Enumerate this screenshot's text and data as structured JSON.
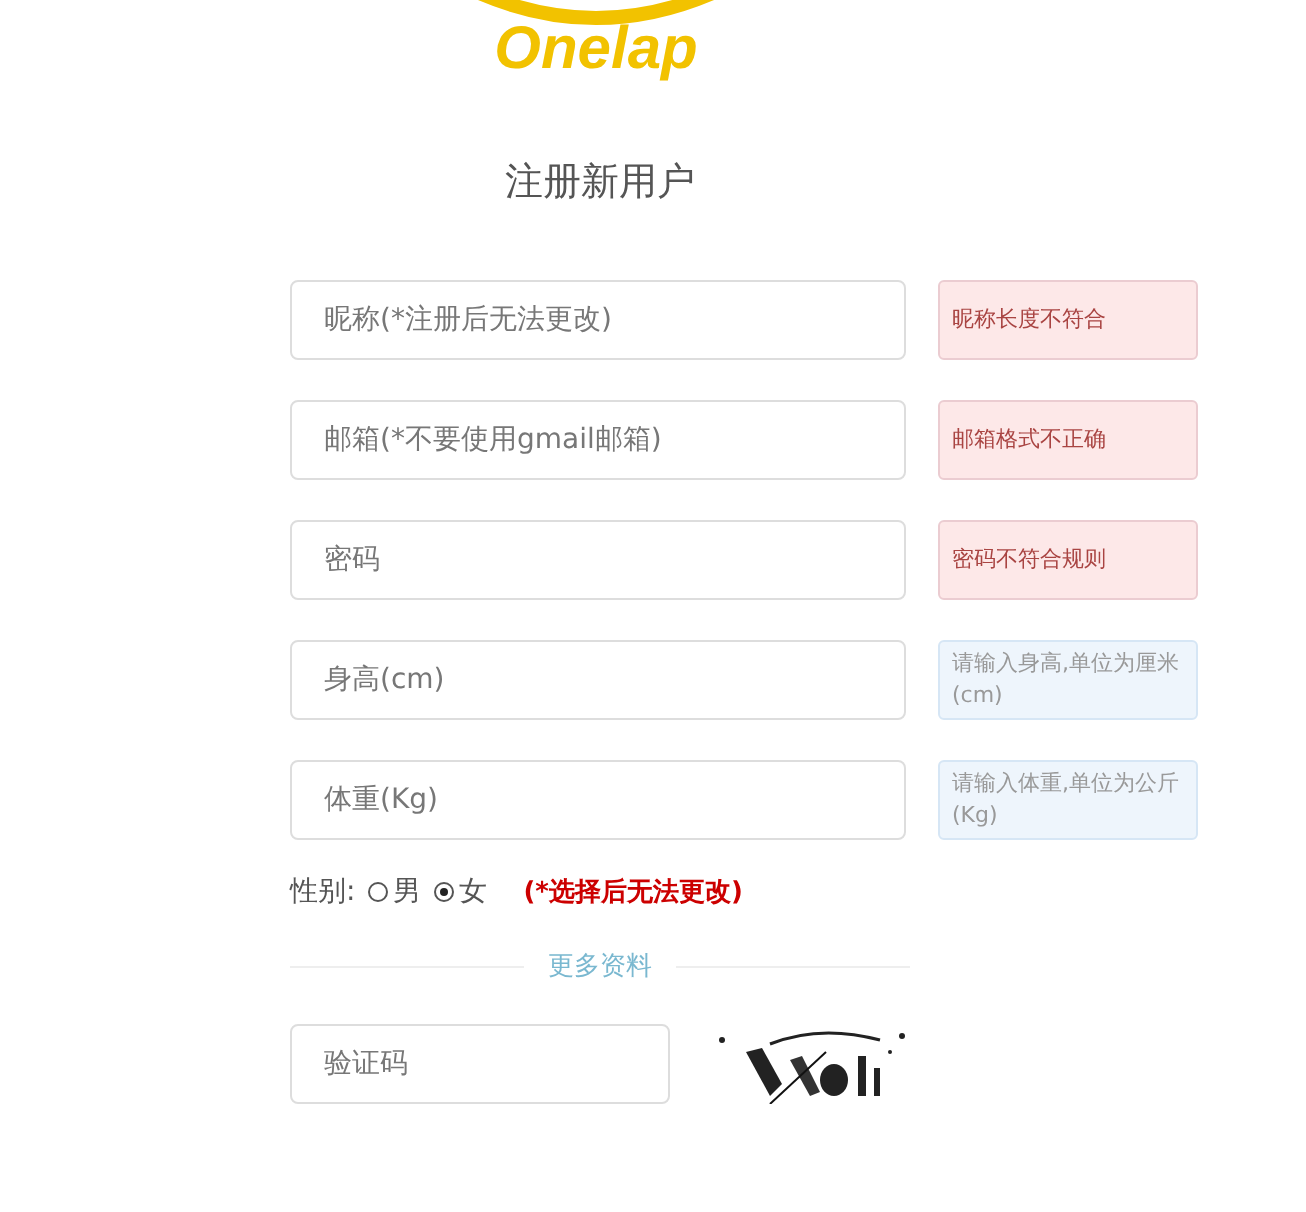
{
  "logo": {
    "text": "Onelap"
  },
  "title": "注册新用户",
  "fields": [
    {
      "placeholder": "昵称(*注册后无法更改)",
      "hint": {
        "kind": "error",
        "text": "昵称长度不符合"
      }
    },
    {
      "placeholder": "邮箱(*不要使用gmail邮箱)",
      "hint": {
        "kind": "error",
        "text": "邮箱格式不正确"
      }
    },
    {
      "placeholder": "密码",
      "hint": {
        "kind": "error",
        "text": "密码不符合规则"
      }
    },
    {
      "placeholder": "身高(cm)",
      "hint": {
        "kind": "info",
        "text": "请输入身高,单位为厘米(cm)"
      }
    },
    {
      "placeholder": "体重(Kg)",
      "hint": {
        "kind": "info",
        "text": "请输入体重,单位为公斤(Kg)"
      }
    }
  ],
  "gender": {
    "label": "性别:",
    "options": [
      {
        "label": "男",
        "selected": false
      },
      {
        "label": "女",
        "selected": true
      }
    ],
    "note": "(*选择后无法更改)"
  },
  "more_link": "更多资料",
  "captcha": {
    "placeholder": "验证码"
  }
}
